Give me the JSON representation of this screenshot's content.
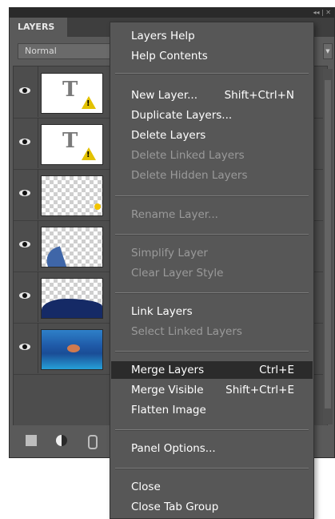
{
  "panel": {
    "tab_label": "LAYERS",
    "blend_mode": "Normal",
    "window_controls": "◂◂ | ✕"
  },
  "layers": [
    {
      "type": "text"
    },
    {
      "type": "text"
    },
    {
      "type": "transparent-fish"
    },
    {
      "type": "dolphin"
    },
    {
      "type": "wave"
    },
    {
      "type": "pool-photo"
    }
  ],
  "menu": {
    "items": [
      {
        "label": "Layers Help",
        "shortcut": "",
        "enabled": true
      },
      {
        "label": "Help Contents",
        "shortcut": "",
        "enabled": true
      },
      {
        "label": "New Layer...",
        "shortcut": "Shift+Ctrl+N",
        "enabled": true
      },
      {
        "label": "Duplicate Layers...",
        "shortcut": "",
        "enabled": true
      },
      {
        "label": "Delete Layers",
        "shortcut": "",
        "enabled": true
      },
      {
        "label": "Delete Linked Layers",
        "shortcut": "",
        "enabled": false
      },
      {
        "label": "Delete Hidden Layers",
        "shortcut": "",
        "enabled": false
      },
      {
        "label": "Rename Layer...",
        "shortcut": "",
        "enabled": false
      },
      {
        "label": "Simplify Layer",
        "shortcut": "",
        "enabled": false
      },
      {
        "label": "Clear Layer Style",
        "shortcut": "",
        "enabled": false
      },
      {
        "label": "Link Layers",
        "shortcut": "",
        "enabled": true
      },
      {
        "label": "Select Linked Layers",
        "shortcut": "",
        "enabled": false
      },
      {
        "label": "Merge Layers",
        "shortcut": "Ctrl+E",
        "enabled": true,
        "highlighted": true
      },
      {
        "label": "Merge Visible",
        "shortcut": "Shift+Ctrl+E",
        "enabled": true
      },
      {
        "label": "Flatten Image",
        "shortcut": "",
        "enabled": true
      },
      {
        "label": "Panel Options...",
        "shortcut": "",
        "enabled": true
      },
      {
        "label": "Close",
        "shortcut": "",
        "enabled": true
      },
      {
        "label": "Close Tab Group",
        "shortcut": "",
        "enabled": true
      }
    ]
  },
  "icons": {
    "visibility": "eye-icon",
    "warning": "warning-icon",
    "new_layer": "new-layer-icon",
    "adjustment": "adjustment-layer-icon",
    "link": "link-icon"
  },
  "colors": {
    "panel_bg": "#5a5a5a",
    "menu_bg": "#575757",
    "menu_highlight": "#2b2b2b",
    "disabled_text": "#9a9a9a"
  }
}
